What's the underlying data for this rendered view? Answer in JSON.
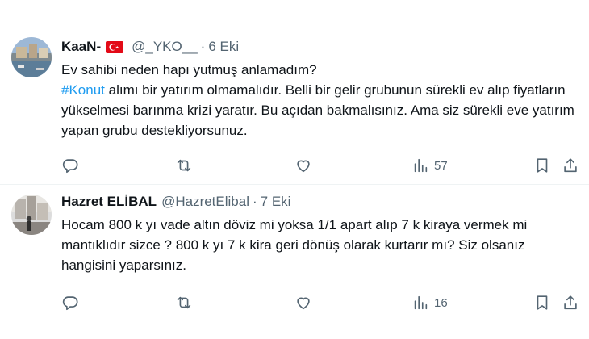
{
  "tweets": [
    {
      "name": "KaaN-",
      "handle": "@_YKO__",
      "separator": "·",
      "time": "6 Eki",
      "text_line1": "Ev sahibi neden hapı yutmuş anlamadım?",
      "hashtag": "#Konut",
      "text_after_hashtag": " alımı bir yatırım olmamalıdır. Belli bir gelir grubunun sürekli ev alıp fiyatların yükselmesi barınma krizi yaratır. Bu açıdan bakmalısınız. Ama siz sürekli eve yatırım yapan grubu destekliyorsunuz.",
      "views": "57"
    },
    {
      "name": "Hazret ELİBAL",
      "handle": "@HazretElibal",
      "separator": "·",
      "time": "7 Eki",
      "text": "Hocam 800 k yı vade altın döviz mi yoksa 1/1 apart alıp 7 k kiraya vermek mi mantıklıdır sizce ? 800 k yı 7 k kira geri dönüş olarak kurtarır mı? Siz olsanız hangisini yaparsınız.",
      "views": "16"
    }
  ],
  "colors": {
    "text": "#0f1419",
    "secondary": "#536471",
    "link": "#1d9bf0",
    "divider": "#eff3f4",
    "flag": "#e30a17"
  },
  "icons": [
    "reply-icon",
    "retweet-icon",
    "like-icon",
    "views-icon",
    "bookmark-icon",
    "share-icon",
    "turkey-flag-icon"
  ]
}
